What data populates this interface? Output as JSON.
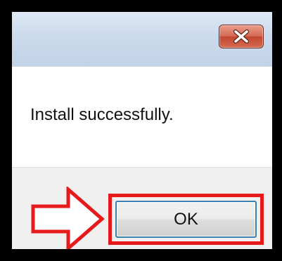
{
  "dialog": {
    "message": "Install successfully.",
    "ok_label": "OK",
    "close_icon": "close-icon",
    "annotation_icon": "right-arrow-icon"
  },
  "colors": {
    "titlebar": "#c9d8ec",
    "close_button": "#c9503a",
    "highlight": "#e8191a",
    "ok_border": "#3c7fb1"
  }
}
